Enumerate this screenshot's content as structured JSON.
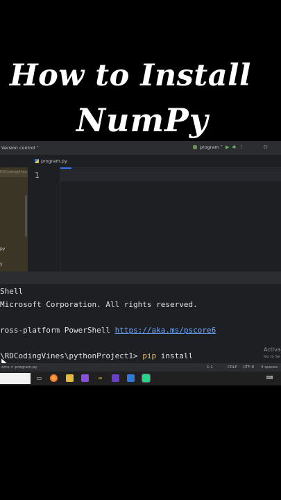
{
  "overlay_title": {
    "line1": "How to Install",
    "line2": "NumPy"
  },
  "ide": {
    "topbar": {
      "version_control": "Version control ˅",
      "run_config": "program ˅"
    },
    "tab": {
      "label": "program.py"
    },
    "project": {
      "header": "RDCodingVines D:",
      "items": [
        "py",
        "y"
      ]
    },
    "editor": {
      "line_number": "1"
    },
    "terminal": {
      "lines": [
        "Shell",
        " Microsoft Corporation. All rights reserved.",
        "ross-platform PowerShell ",
        "\\RDCodingVines\\pythonProject1> "
      ],
      "link": "https://aka.ms/pscore6",
      "cmd_pip": "pip",
      "cmd_rest": " install"
    },
    "activate": {
      "line1": "Activa",
      "line2": "Go to Se"
    },
    "status": {
      "breadcrumb": "ams  >  program.py",
      "position": "1:1",
      "line_sep": "CRLF",
      "encoding": "UTF-8",
      "indent": "4 spaces"
    }
  },
  "taskbar": {
    "icons": [
      "task-view-icon",
      "firefox-icon",
      "file-explorer-icon",
      "visual-studio-icon",
      "app-icon",
      "vs-icon",
      "store-icon",
      "pycharm-icon"
    ]
  },
  "colors": {
    "accent": "#3574f0",
    "link": "#6fa8ff",
    "project_bg": "#3b3526",
    "ide_bg": "#1e1f22"
  }
}
